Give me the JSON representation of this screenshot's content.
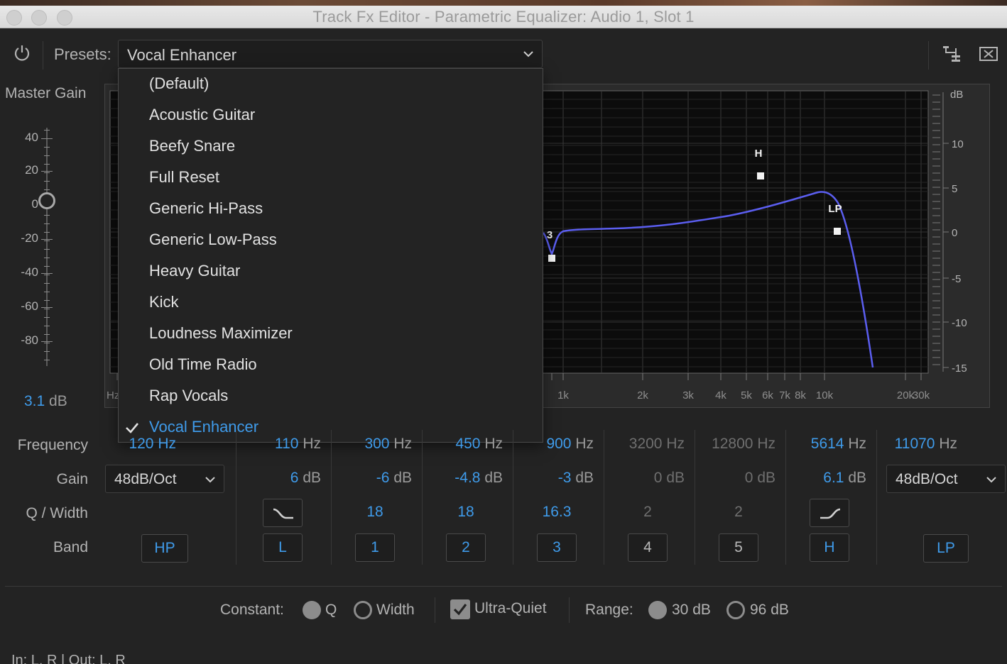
{
  "window": {
    "title": "Track Fx Editor - Parametric Equalizer: Audio 1, Slot 1"
  },
  "toolbar": {
    "presets_label": "Presets:",
    "preset_value": "Vocal Enhancer"
  },
  "master_gain": {
    "label": "Master Gain",
    "ticks": [
      "40",
      "20",
      "0",
      "-20",
      "-40",
      "-60",
      "-80"
    ],
    "value": "3.1",
    "unit": "dB"
  },
  "graph": {
    "hz_label": "Hz",
    "db_label": "dB",
    "freq_ticks": [
      "1k",
      "2k",
      "3k",
      "4k",
      "5k",
      "6k",
      "7k",
      "8k",
      "10k",
      "20k",
      "30k"
    ],
    "db_ticks": [
      "10",
      "5",
      "0",
      "-5",
      "-10",
      "-15"
    ],
    "handles": [
      "3",
      "H",
      "LP"
    ],
    "curve_color": "#5b5ef0"
  },
  "menu": {
    "items": [
      "(Default)",
      "Acoustic Guitar",
      "Beefy Snare",
      "Full Reset",
      "Generic Hi-Pass",
      "Generic Low-Pass",
      "Heavy Guitar",
      "Kick",
      "Loudness Maximizer",
      "Old Time Radio",
      "Rap Vocals",
      "Vocal Enhancer"
    ],
    "selected": "Vocal Enhancer"
  },
  "rows": {
    "frequency": "Frequency",
    "gain": "Gain",
    "q": "Q / Width",
    "band": "Band"
  },
  "hp": {
    "freq": "120",
    "unit": "Hz",
    "slope": "48dB/Oct",
    "band": "HP"
  },
  "bands": [
    {
      "freq": "110",
      "freq_unit": "Hz",
      "gain": "6",
      "gain_unit": "dB",
      "band": "L"
    },
    {
      "freq": "300",
      "freq_unit": "Hz",
      "gain": "-6",
      "gain_unit": "dB",
      "q": "18",
      "band": "1"
    },
    {
      "freq": "450",
      "freq_unit": "Hz",
      "gain": "-4.8",
      "gain_unit": "dB",
      "q": "18",
      "band": "2"
    },
    {
      "freq": "900",
      "freq_unit": "Hz",
      "gain": "-3",
      "gain_unit": "dB",
      "q": "16.3",
      "band": "3"
    },
    {
      "freq": "3200",
      "freq_unit": "Hz",
      "gain": "0",
      "gain_unit": "dB",
      "q": "2",
      "band": "4"
    },
    {
      "freq": "12800",
      "freq_unit": "Hz",
      "gain": "0",
      "gain_unit": "dB",
      "q": "2",
      "band": "5"
    },
    {
      "freq": "5614",
      "freq_unit": "Hz",
      "gain": "6.1",
      "gain_unit": "dB",
      "band": "H"
    }
  ],
  "lp": {
    "freq": "11070",
    "unit": "Hz",
    "slope": "48dB/Oct",
    "band": "LP"
  },
  "options": {
    "constant_label": "Constant:",
    "q_label": "Q",
    "width_label": "Width",
    "ultra_quiet_label": "Ultra-Quiet",
    "range_label": "Range:",
    "range_30": "30 dB",
    "range_96": "96 dB"
  },
  "io": "In: L, R | Out: L, R"
}
